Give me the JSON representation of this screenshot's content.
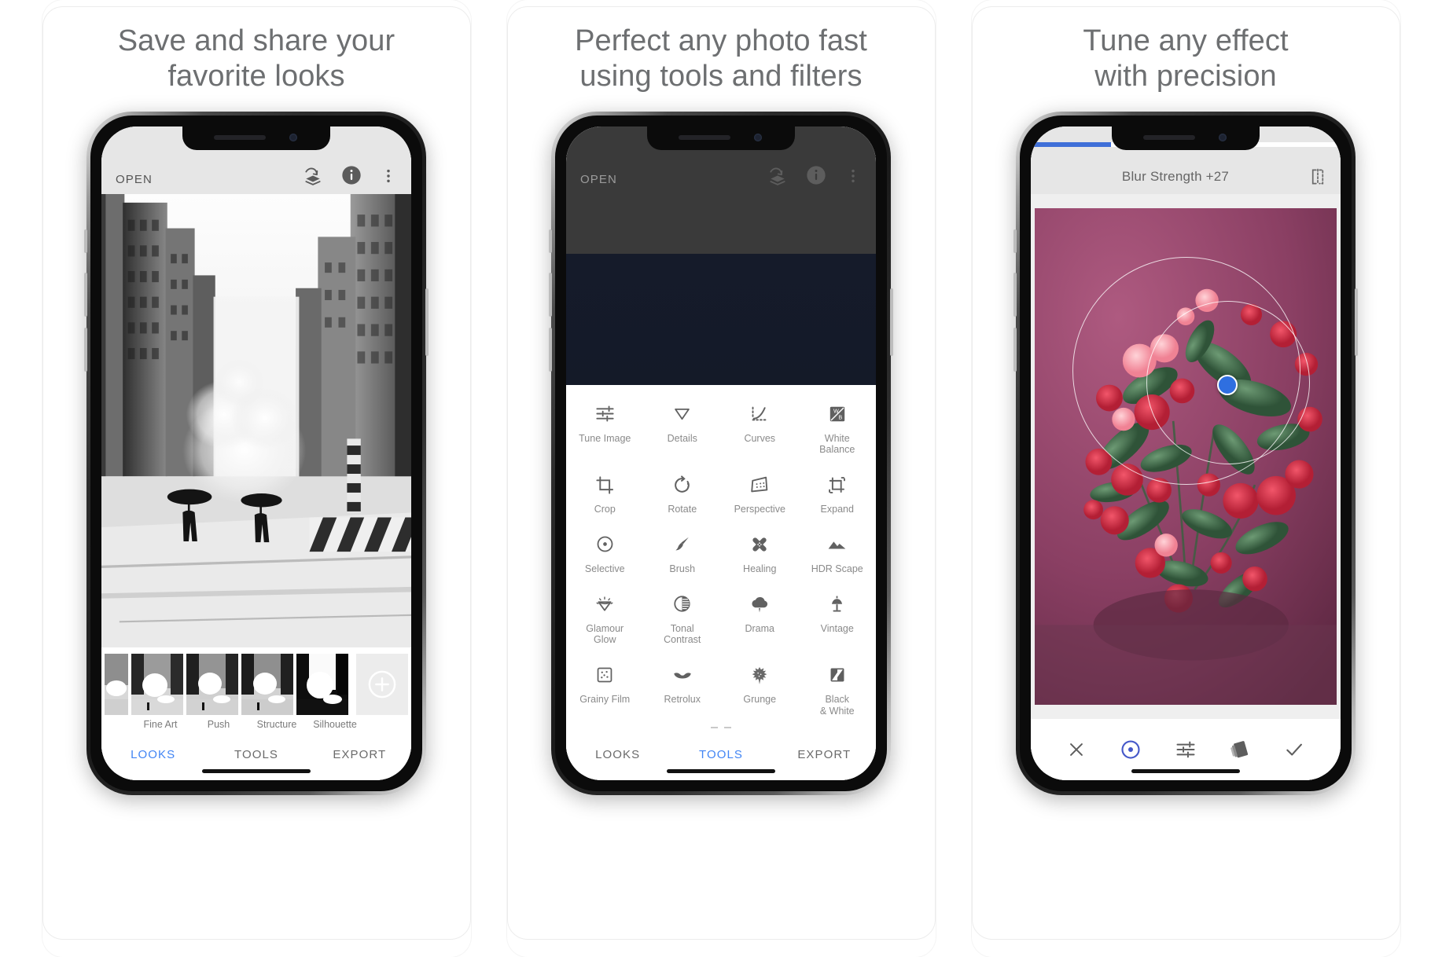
{
  "page": {
    "background": "#ffffff",
    "accent": "#4285f4",
    "progress_accent": "#3f6fd8"
  },
  "cards": [
    {
      "headline": "Save and share your\nfavorite looks",
      "app": {
        "open_label": "OPEN",
        "top_icons": [
          "stack-undo-icon",
          "info-icon",
          "overflow-menu-icon"
        ],
        "looks": {
          "add_button_icon": "add-look-icon",
          "items": [
            {
              "label": ""
            },
            {
              "label": "Fine Art"
            },
            {
              "label": "Push"
            },
            {
              "label": "Structure"
            },
            {
              "label": "Silhouette"
            }
          ]
        },
        "tabs": [
          {
            "label": "LOOKS",
            "active": true
          },
          {
            "label": "TOOLS",
            "active": false
          },
          {
            "label": "EXPORT",
            "active": false
          }
        ]
      }
    },
    {
      "headline": "Perfect any photo fast\nusing tools and filters",
      "app": {
        "open_label": "OPEN",
        "top_icons": [
          "stack-undo-icon",
          "info-icon",
          "overflow-menu-icon"
        ],
        "tools": [
          {
            "label": "Tune Image",
            "icon": "tune-image-icon"
          },
          {
            "label": "Details",
            "icon": "details-icon"
          },
          {
            "label": "Curves",
            "icon": "curves-icon"
          },
          {
            "label": "White\nBalance",
            "icon": "white-balance-icon"
          },
          {
            "label": "Crop",
            "icon": "crop-icon"
          },
          {
            "label": "Rotate",
            "icon": "rotate-icon"
          },
          {
            "label": "Perspective",
            "icon": "perspective-icon"
          },
          {
            "label": "Expand",
            "icon": "expand-icon"
          },
          {
            "label": "Selective",
            "icon": "selective-icon"
          },
          {
            "label": "Brush",
            "icon": "brush-icon"
          },
          {
            "label": "Healing",
            "icon": "healing-icon"
          },
          {
            "label": "HDR Scape",
            "icon": "hdr-scape-icon"
          },
          {
            "label": "Glamour\nGlow",
            "icon": "glamour-glow-icon"
          },
          {
            "label": "Tonal\nContrast",
            "icon": "tonal-contrast-icon"
          },
          {
            "label": "Drama",
            "icon": "drama-icon"
          },
          {
            "label": "Vintage",
            "icon": "vintage-icon"
          },
          {
            "label": "Grainy Film",
            "icon": "grainy-film-icon"
          },
          {
            "label": "Retrolux",
            "icon": "retrolux-icon"
          },
          {
            "label": "Grunge",
            "icon": "grunge-icon"
          },
          {
            "label": "Black\n& White",
            "icon": "black-and-white-icon"
          }
        ],
        "tabs": [
          {
            "label": "LOOKS",
            "active": false
          },
          {
            "label": "TOOLS",
            "active": true
          },
          {
            "label": "EXPORT",
            "active": false
          }
        ]
      }
    },
    {
      "headline": "Tune any effect\nwith precision",
      "app": {
        "title": "Blur Strength +27",
        "compare_icon": "compare-split-icon",
        "progress_percent": 26,
        "bottom_icons": [
          "close-icon",
          "selective-point-icon",
          "adjust-sliders-icon",
          "stack-cards-icon",
          "check-icon"
        ]
      }
    }
  ]
}
